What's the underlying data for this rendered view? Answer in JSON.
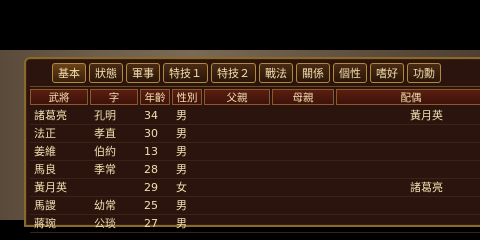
{
  "tabs": [
    "基本",
    "狀態",
    "軍事",
    "特技１",
    "特技２",
    "戰法",
    "關係",
    "個性",
    "嗜好",
    "功勳"
  ],
  "columns": [
    "武將",
    "字",
    "年齡",
    "性別",
    "父親",
    "母親",
    "配偶"
  ],
  "rows": [
    {
      "name": "諸葛亮",
      "style": "孔明",
      "age": "34",
      "sex": "男",
      "spouse": "黃月英"
    },
    {
      "name": "法正",
      "style": "孝直",
      "age": "30",
      "sex": "男",
      "spouse": ""
    },
    {
      "name": "姜維",
      "style": "伯約",
      "age": "13",
      "sex": "男",
      "spouse": ""
    },
    {
      "name": "馬良",
      "style": "季常",
      "age": "28",
      "sex": "男",
      "spouse": ""
    },
    {
      "name": "黃月英",
      "style": "",
      "age": "29",
      "sex": "女",
      "spouse": "諸葛亮"
    },
    {
      "name": "馬謖",
      "style": "幼常",
      "age": "25",
      "sex": "男",
      "spouse": ""
    },
    {
      "name": "蔣琬",
      "style": "公琰",
      "age": "27",
      "sex": "男",
      "spouse": ""
    }
  ]
}
